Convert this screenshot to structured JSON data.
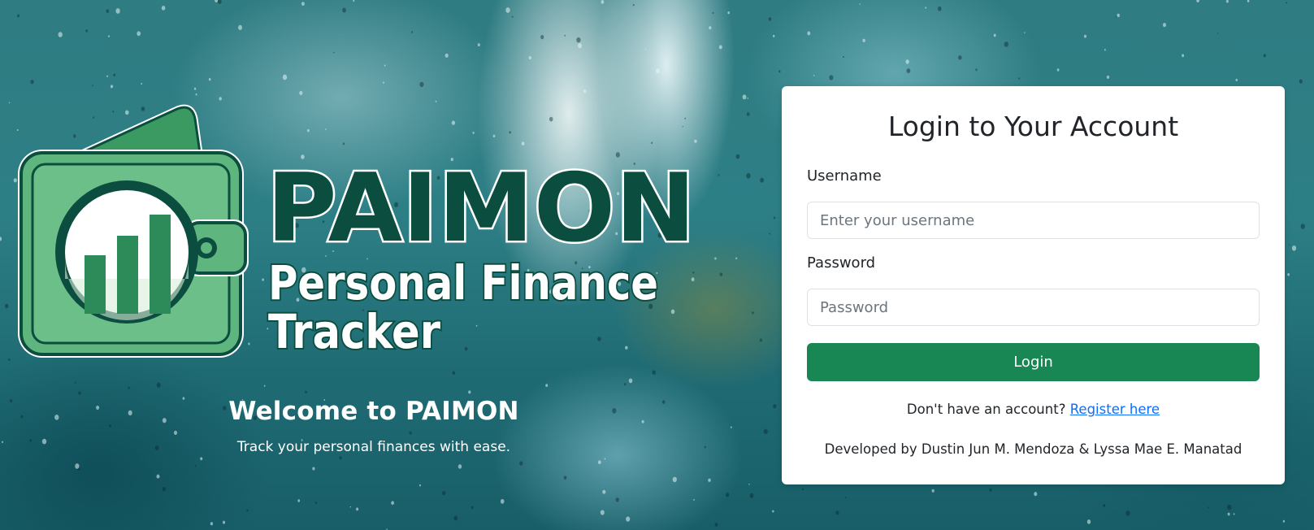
{
  "brand": {
    "name": "PAIMON",
    "tagline_line1": "Personal Finance",
    "tagline_line2": "Tracker",
    "logo_icon": "wallet-chart-icon",
    "primary_color": "#0b4d3f",
    "accent_color": "#4ea870"
  },
  "welcome": {
    "title": "Welcome to PAIMON",
    "subtitle": "Track your personal finances with ease."
  },
  "login": {
    "title": "Login to Your Account",
    "username_label": "Username",
    "username_placeholder": "Enter your username",
    "username_value": "",
    "password_label": "Password",
    "password_placeholder": "Password",
    "password_value": "",
    "submit_label": "Login",
    "submit_color": "#198754",
    "register_prompt": "Don't have an account?",
    "register_link": "Register here",
    "link_color": "#0d6efd",
    "credits": "Developed by Dustin Jun M. Mendoza & Lyssa Mae E. Manatad"
  }
}
